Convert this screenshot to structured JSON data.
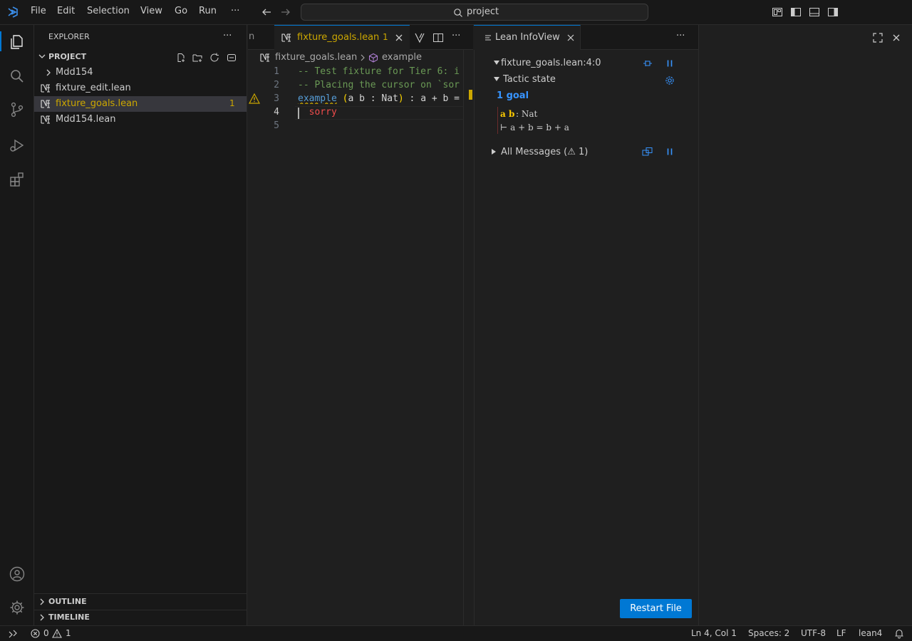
{
  "titlebar": {
    "menu": [
      "File",
      "Edit",
      "Selection",
      "View",
      "Go",
      "Run",
      "···"
    ],
    "search": "project"
  },
  "sidebar": {
    "header": "EXPLORER",
    "project_label": "PROJECT",
    "tree": [
      {
        "label": "Mdd154",
        "type": "folder"
      },
      {
        "label": "fixture_edit.lean",
        "type": "file"
      },
      {
        "label": "fixture_goals.lean",
        "type": "file",
        "badge": "1",
        "selected": true
      },
      {
        "label": "Mdd154.lean",
        "type": "file"
      }
    ],
    "outline_label": "OUTLINE",
    "timeline_label": "TIMELINE"
  },
  "editor": {
    "prev_tab_tail": "n",
    "active_tab": "fixture_goals.lean",
    "active_tab_badge": "1",
    "breadcrumb_file": "fixture_goals.lean",
    "breadcrumb_symbol": "example",
    "line_numbers": [
      "1",
      "2",
      "3",
      "4",
      "5"
    ],
    "lines": [
      "-- Test fixture for Tier 6: i",
      "-- Placing the cursor on `sor",
      "example (a b : Nat) : a + b =",
      "  sorry",
      ""
    ]
  },
  "infoview": {
    "tab_title": "Lean InfoView",
    "position": "fixture_goals.lean:4:0",
    "tactic_state_label": "Tactic state",
    "goal_count": "1 goal",
    "hyp_names": "a b",
    "hyp_type": ": Nat",
    "goal": "⊢ a + b = b + a",
    "all_messages": "All Messages (⚠ 1)",
    "restart_button": "Restart File"
  },
  "statusbar": {
    "errors": "0",
    "warnings": "1",
    "cursor": "Ln 4, Col 1",
    "spaces": "Spaces: 2",
    "encoding": "UTF-8",
    "eol": "LF",
    "language": "lean4"
  },
  "colors": {
    "accent": "#0078d4",
    "modified": "#e2c08d",
    "comment": "#6a9955",
    "keyword": "#569cd6",
    "error": "#f14c4c",
    "warning": "#cca700"
  }
}
